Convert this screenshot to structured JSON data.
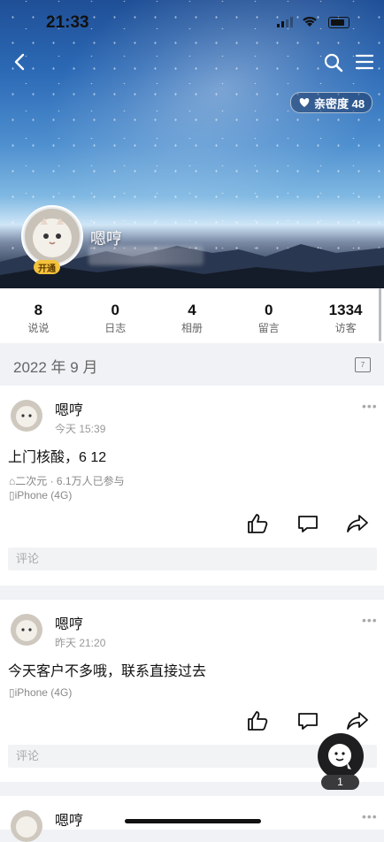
{
  "status_bar": {
    "time": "21:33"
  },
  "header": {
    "intimacy_label": "亲密度 48",
    "vip_label": "开通"
  },
  "profile": {
    "name": "嗯哼"
  },
  "stats": [
    {
      "num": "8",
      "label": "说说"
    },
    {
      "num": "0",
      "label": "日志"
    },
    {
      "num": "4",
      "label": "相册"
    },
    {
      "num": "0",
      "label": "留言"
    },
    {
      "num": "1334",
      "label": "访客"
    }
  ],
  "month_label": "2022 年 9 月",
  "calendar_day": "7",
  "posts": [
    {
      "author": "嗯哼",
      "time": "今天 15:39",
      "text": "上门核酸，6 12",
      "tag": "二次元 · 6.1万人已参与",
      "device": "iPhone (4G)",
      "comment_placeholder": "评论"
    },
    {
      "author": "嗯哼",
      "time": "昨天 21:20",
      "text": "今天客户不多哦，联系直接过去",
      "device": "iPhone (4G)",
      "comment_placeholder": "评论"
    },
    {
      "author": "嗯哼"
    }
  ],
  "float_badge": "1",
  "icons": [
    "back-icon",
    "search-icon",
    "menu-icon",
    "heart-icon",
    "calendar-icon",
    "like-icon",
    "comment-icon",
    "share-icon",
    "tag-icon",
    "phone-icon",
    "ellipsis-icon",
    "chat-assistant-icon"
  ]
}
